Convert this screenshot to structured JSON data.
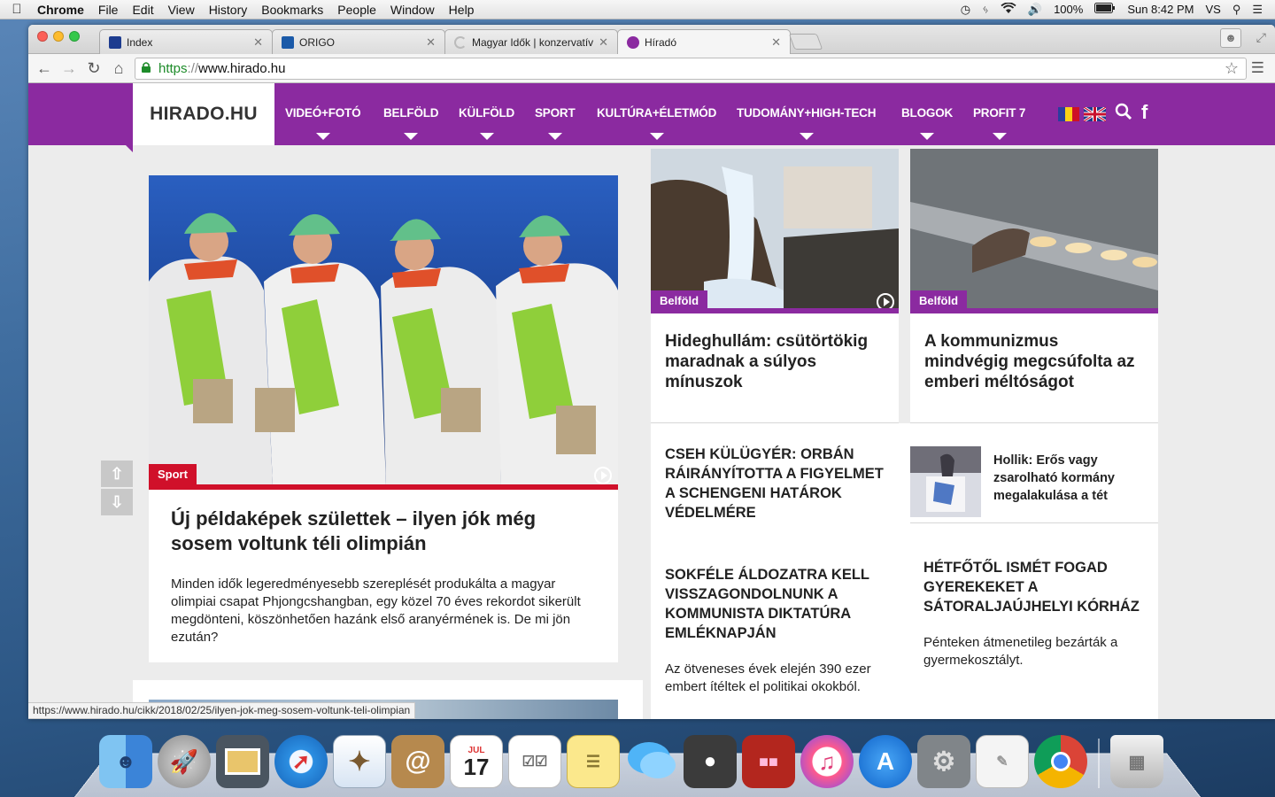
{
  "menubar": {
    "app_name": "Chrome",
    "items": [
      "File",
      "Edit",
      "View",
      "History",
      "Bookmarks",
      "People",
      "Window",
      "Help"
    ],
    "battery": "100%",
    "clock": "Sun 8:42 PM",
    "user": "VS"
  },
  "browser": {
    "tabs": [
      {
        "title": "Index",
        "favicon_color": "#1d3c8f"
      },
      {
        "title": "ORIGO",
        "favicon_color": "#1b5aa8"
      },
      {
        "title": "Magyar Idők | konzervatív",
        "favicon_color": "#bbbbbb"
      },
      {
        "title": "Híradó",
        "favicon_color": "#8b2aa0"
      }
    ],
    "url_scheme": "https",
    "url_sep": "://",
    "url_host": "www.hirado.hu",
    "status_url": "https://www.hirado.hu/cikk/2018/02/25/ilyen-jok-meg-sosem-voltunk-teli-olimpian"
  },
  "site": {
    "logo": "HIRADO.HU",
    "accent_color": "#8b2aa0",
    "nav": [
      "VIDEÓ+FOTÓ",
      "BELFÖLD",
      "KÜLFÖLD",
      "SPORT",
      "KULTÚRA+ÉLETMÓD",
      "TUDOMÁNY+HIGH-TECH",
      "BLOGOK",
      "PROFIT 7"
    ]
  },
  "main_story": {
    "tag": "Sport",
    "title": "Új példaképek születtek – ilyen jók még sosem voltunk téli olimpián",
    "lead": "Minden idők legeredményesebb szereplését produkálta a magyar olimpiai csapat Phjongcshangban, egy közel 70 éves rekordot sikerült megdönteni, köszönhetően hazánk első aranyérmének is. De mi jön ezután?"
  },
  "cards": [
    {
      "tag": "Belföld",
      "title": "Hideghullám: csütörtökig maradnak a súlyos mínuszok"
    },
    {
      "tag": "Belföld",
      "title": "A kommunizmus mindvégig megcsúfolta az emberi méltóságot"
    }
  ],
  "headlines": [
    {
      "title": "CSEH KÜLÜGYÉR: ORBÁN RÁIRÁNYÍTOTTA A FIGYELMET A SCHENGENI HATÁROK VÉDELMÉRE"
    },
    {
      "title": "Hollik: Erős vagy zsarolható kormány megalakulása a tét"
    },
    {
      "title": "SOKFÉLE ÁLDOZATRA KELL VISSZAGONDOLNUNK A KOMMUNISTA DIKTATÚRA EMLÉKNAPJÁN",
      "lead": "Az ötveneses évek elején 390 ezer embert ítéltek el politikai okokból."
    },
    {
      "title": "HÉTFŐTŐL ISMÉT FOGAD GYEREKEKET A SÁTORALJAÚJHELYI KÓRHÁZ",
      "lead": "Pénteken átmenetileg bezárták a gyermekosztályt."
    }
  ],
  "dock": {
    "icons": [
      "finder-icon",
      "launchpad-icon",
      "photo-browser-icon",
      "safari-icon",
      "mail-icon",
      "contacts-icon",
      "calendar-icon",
      "reminders-icon",
      "notes-icon",
      "messages-icon",
      "facetime-icon",
      "photo-booth-icon",
      "itunes-icon",
      "app-store-icon",
      "system-preferences-icon",
      "textedit-icon",
      "chrome-icon",
      "trash-icon"
    ],
    "calendar_month": "JUL",
    "calendar_day": "17"
  }
}
